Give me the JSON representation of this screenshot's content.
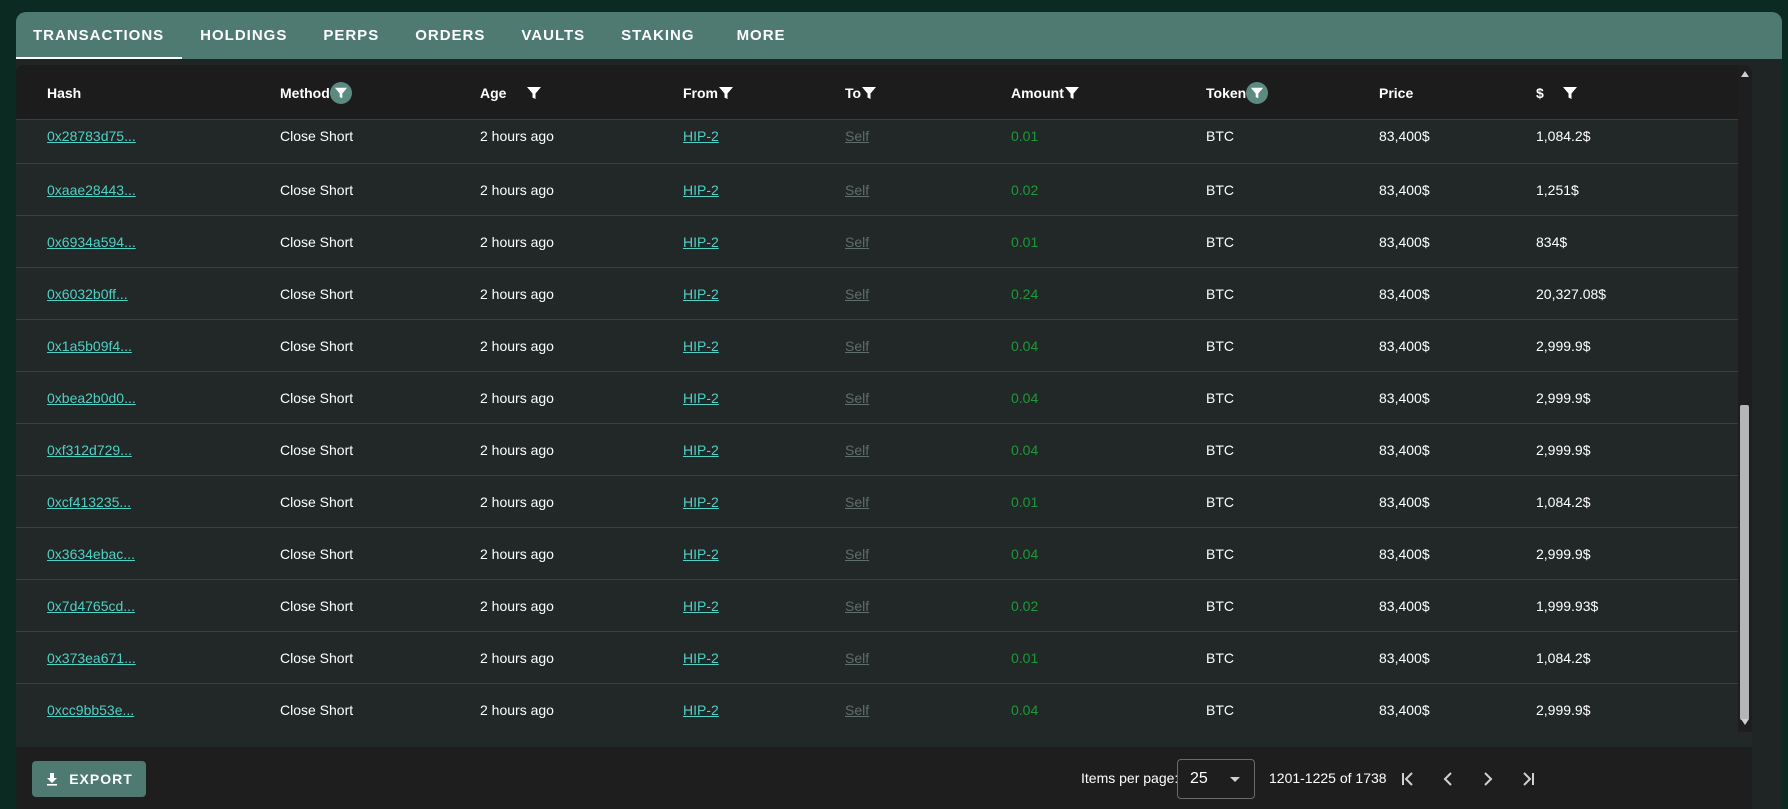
{
  "tabs": [
    {
      "label": "TRANSACTIONS",
      "active": true
    },
    {
      "label": "HOLDINGS",
      "active": false
    },
    {
      "label": "PERPS",
      "active": false
    },
    {
      "label": "ORDERS",
      "active": false
    },
    {
      "label": "VAULTS",
      "active": false
    },
    {
      "label": "STAKING",
      "active": false
    },
    {
      "label": "MORE",
      "active": false
    }
  ],
  "table": {
    "columns": {
      "hash": "Hash",
      "method": "Method",
      "age": "Age",
      "from": "From",
      "to": "To",
      "amount": "Amount",
      "token": "Token",
      "price": "Price",
      "usd": "$"
    },
    "rows": [
      {
        "hash": "0x28783d75...",
        "method": "Close Short",
        "age": "2 hours ago",
        "from": "HIP-2",
        "to": "Self",
        "amount": "0.01",
        "token": "BTC",
        "price": "83,400$",
        "usd": "1,084.2$"
      },
      {
        "hash": "0xaae28443...",
        "method": "Close Short",
        "age": "2 hours ago",
        "from": "HIP-2",
        "to": "Self",
        "amount": "0.02",
        "token": "BTC",
        "price": "83,400$",
        "usd": "1,251$"
      },
      {
        "hash": "0x6934a594...",
        "method": "Close Short",
        "age": "2 hours ago",
        "from": "HIP-2",
        "to": "Self",
        "amount": "0.01",
        "token": "BTC",
        "price": "83,400$",
        "usd": "834$"
      },
      {
        "hash": "0x6032b0ff...",
        "method": "Close Short",
        "age": "2 hours ago",
        "from": "HIP-2",
        "to": "Self",
        "amount": "0.24",
        "token": "BTC",
        "price": "83,400$",
        "usd": "20,327.08$"
      },
      {
        "hash": "0x1a5b09f4...",
        "method": "Close Short",
        "age": "2 hours ago",
        "from": "HIP-2",
        "to": "Self",
        "amount": "0.04",
        "token": "BTC",
        "price": "83,400$",
        "usd": "2,999.9$"
      },
      {
        "hash": "0xbea2b0d0...",
        "method": "Close Short",
        "age": "2 hours ago",
        "from": "HIP-2",
        "to": "Self",
        "amount": "0.04",
        "token": "BTC",
        "price": "83,400$",
        "usd": "2,999.9$"
      },
      {
        "hash": "0xf312d729...",
        "method": "Close Short",
        "age": "2 hours ago",
        "from": "HIP-2",
        "to": "Self",
        "amount": "0.04",
        "token": "BTC",
        "price": "83,400$",
        "usd": "2,999.9$"
      },
      {
        "hash": "0xcf413235...",
        "method": "Close Short",
        "age": "2 hours ago",
        "from": "HIP-2",
        "to": "Self",
        "amount": "0.01",
        "token": "BTC",
        "price": "83,400$",
        "usd": "1,084.2$"
      },
      {
        "hash": "0x3634ebac...",
        "method": "Close Short",
        "age": "2 hours ago",
        "from": "HIP-2",
        "to": "Self",
        "amount": "0.04",
        "token": "BTC",
        "price": "83,400$",
        "usd": "2,999.9$"
      },
      {
        "hash": "0x7d4765cd...",
        "method": "Close Short",
        "age": "2 hours ago",
        "from": "HIP-2",
        "to": "Self",
        "amount": "0.02",
        "token": "BTC",
        "price": "83,400$",
        "usd": "1,999.93$"
      },
      {
        "hash": "0x373ea671...",
        "method": "Close Short",
        "age": "2 hours ago",
        "from": "HIP-2",
        "to": "Self",
        "amount": "0.01",
        "token": "BTC",
        "price": "83,400$",
        "usd": "1,084.2$"
      },
      {
        "hash": "0xcc9bb53e...",
        "method": "Close Short",
        "age": "2 hours ago",
        "from": "HIP-2",
        "to": "Self",
        "amount": "0.04",
        "token": "BTC",
        "price": "83,400$",
        "usd": "2,999.9$"
      }
    ]
  },
  "footer": {
    "export_label": "EXPORT",
    "items_per_page_label": "Items per page:",
    "items_per_page_value": "25",
    "range_text": "1201-1225 of 1738"
  },
  "colors": {
    "background": "#0b2a22",
    "tab_bar": "#4f7a72",
    "link": "#4fd1c5",
    "muted_link": "#5e6e6a",
    "amount": "#1d9a3a"
  }
}
